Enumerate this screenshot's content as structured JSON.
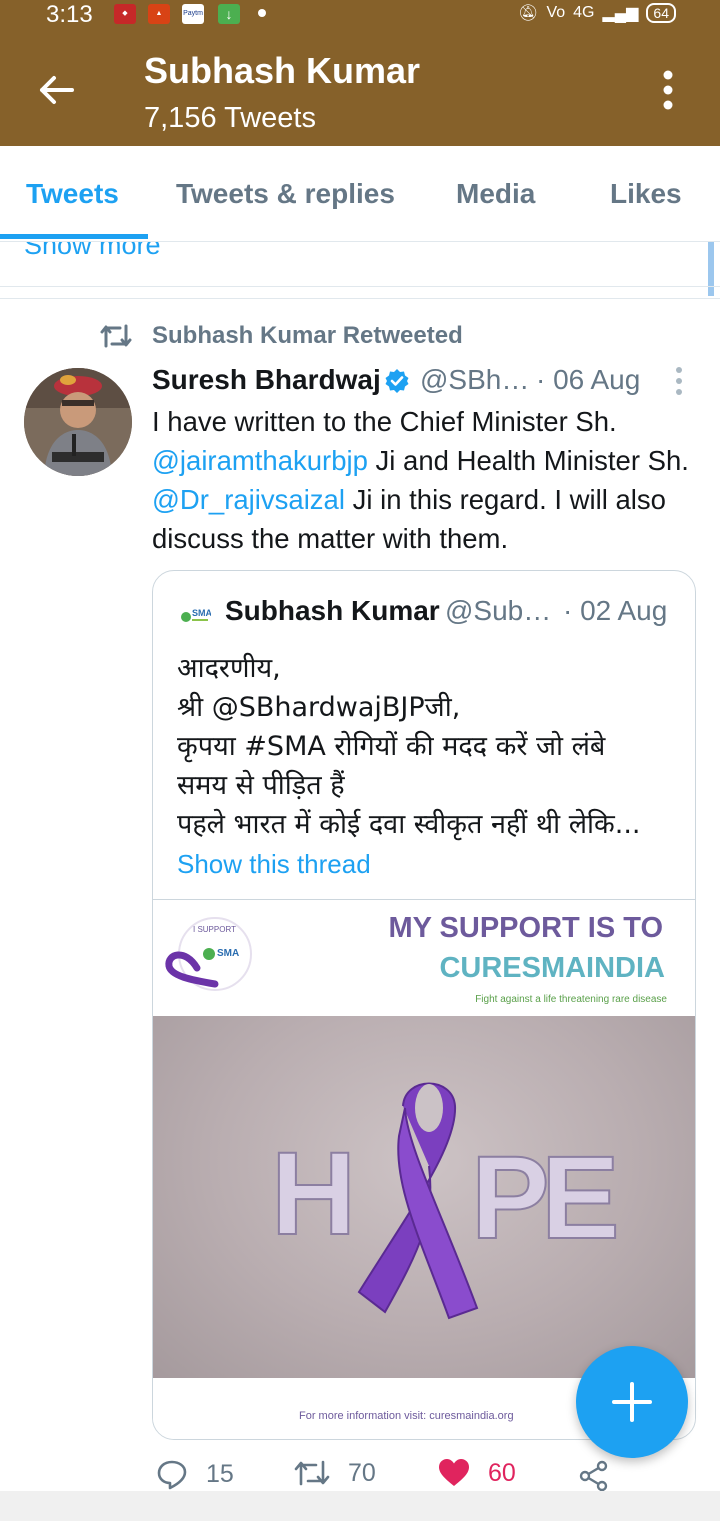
{
  "status_bar": {
    "time": "3:13",
    "battery": "64",
    "network": "4G"
  },
  "app_bar": {
    "profile_name": "Subhash Kumar",
    "tweet_count": "7,156 Tweets"
  },
  "tabs": [
    {
      "label": "Tweets",
      "active": true
    },
    {
      "label": "Tweets & replies",
      "active": false
    },
    {
      "label": "Media",
      "active": false
    },
    {
      "label": "Likes",
      "active": false
    }
  ],
  "previous_item": {
    "show_more": "Show more"
  },
  "tweet": {
    "retweet_label": "Subhash Kumar Retweeted",
    "author_name": "Suresh Bhardwaj",
    "author_handle": "@SBh…",
    "date": "· 06 Aug",
    "text_parts": {
      "p1": "I have written to the Chief Minister Sh. ",
      "m1": "@jairamthakurbjp",
      "p2": " Ji and Health Minister Sh. ",
      "m2": "@Dr_rajivsaizal",
      "p3": " Ji in this regard. I will also discuss the  matter with them."
    },
    "quote": {
      "author_name": "Subhash Kumar",
      "author_handle": "@Sub…",
      "date": "· 02 Aug",
      "lines": [
        "आदरणीय,",
        " श्री @SBhardwajBJPजी,",
        " कृपया #SMA रोगियों की मदद करें जो लंबे",
        "समय से पीड़ित हैं",
        "पहले भारत में कोई दवा स्वीकृत नहीं थी लेकि..."
      ],
      "show_thread": "Show this thread",
      "media": {
        "badge_top": "I SUPPORT",
        "badge_logo": "SMA",
        "banner_line1": "MY SUPPORT IS TO",
        "banner_line2": "CURESMAINDIA",
        "banner_line3": "Fight against a life threatening rare disease",
        "photo_letters": [
          "H",
          "P",
          "E"
        ],
        "footer": "For more information visit: curesmaindia.org"
      }
    },
    "actions": {
      "replies": "15",
      "retweets": "70",
      "likes": "60"
    }
  },
  "colors": {
    "header": "#86612a",
    "accent": "#1da1f2",
    "like": "#e0245e",
    "ribbon": "#6b33a8"
  },
  "icons": [
    "back-arrow-icon",
    "more-vert-icon",
    "retweet-icon",
    "verified-icon",
    "reply-icon",
    "heart-icon",
    "share-icon",
    "compose-plus-icon"
  ]
}
